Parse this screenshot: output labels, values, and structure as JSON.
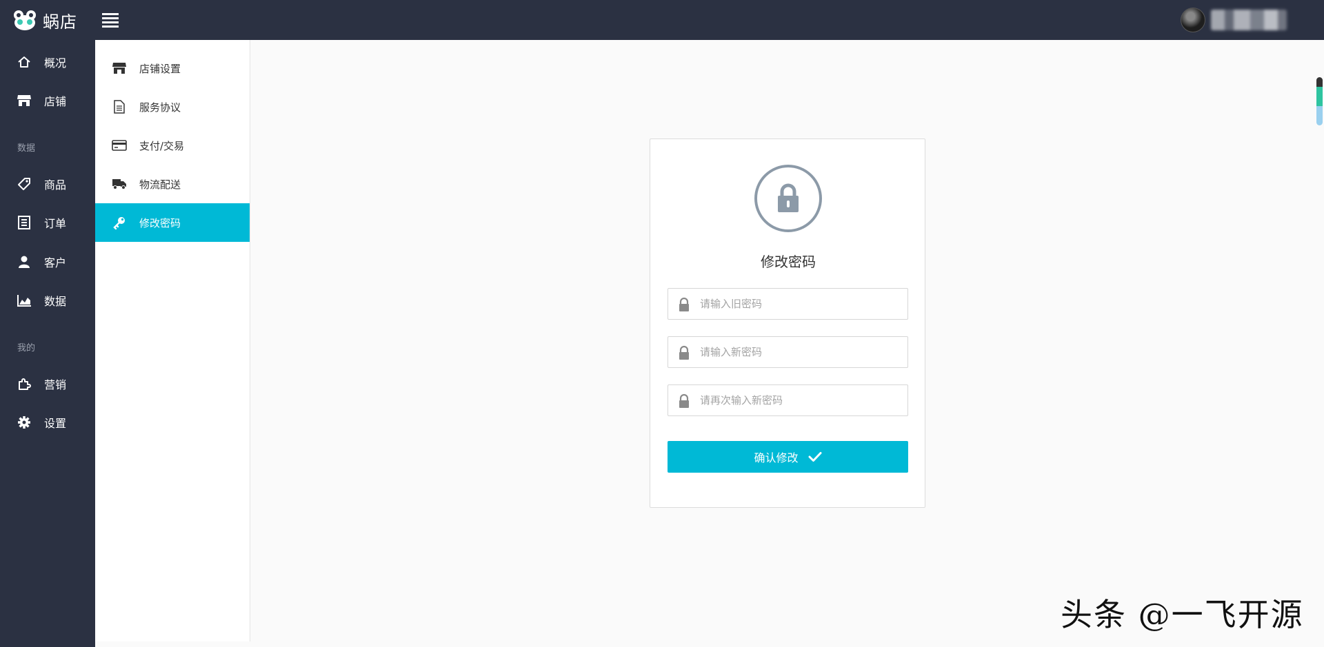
{
  "app": {
    "name": "蜗店"
  },
  "topbar": {
    "menu_icon": "hamburger-icon",
    "avatar_icon": "avatar"
  },
  "primary_nav": {
    "items": [
      {
        "label": "概况",
        "icon": "home-icon"
      },
      {
        "label": "店铺",
        "icon": "store-icon"
      },
      {
        "label": "商品",
        "icon": "tag-icon"
      },
      {
        "label": "订单",
        "icon": "list-icon"
      },
      {
        "label": "客户",
        "icon": "user-icon"
      },
      {
        "label": "数据",
        "icon": "area-chart-icon"
      },
      {
        "label": "营销",
        "icon": "puzzle-icon"
      },
      {
        "label": "设置",
        "icon": "gear-icon"
      }
    ],
    "groups": [
      "数据",
      "我的"
    ]
  },
  "secondary_nav": {
    "items": [
      {
        "label": "店铺设置",
        "icon": "store-icon"
      },
      {
        "label": "服务协议",
        "icon": "document-icon"
      },
      {
        "label": "支付/交易",
        "icon": "credit-card-icon"
      },
      {
        "label": "物流配送",
        "icon": "truck-icon"
      },
      {
        "label": "修改密码",
        "icon": "key-icon",
        "active": true
      }
    ]
  },
  "form": {
    "title": "修改密码",
    "old_password_placeholder": "请输入旧密码",
    "new_password_placeholder": "请输入新密码",
    "confirm_password_placeholder": "请再次输入新密码",
    "submit_label": "确认修改"
  },
  "watermark": "头条 @一飞开源",
  "colors": {
    "sidebar": "#2b3142",
    "accent": "#00b9d6",
    "lock": "#8c9aa8"
  }
}
